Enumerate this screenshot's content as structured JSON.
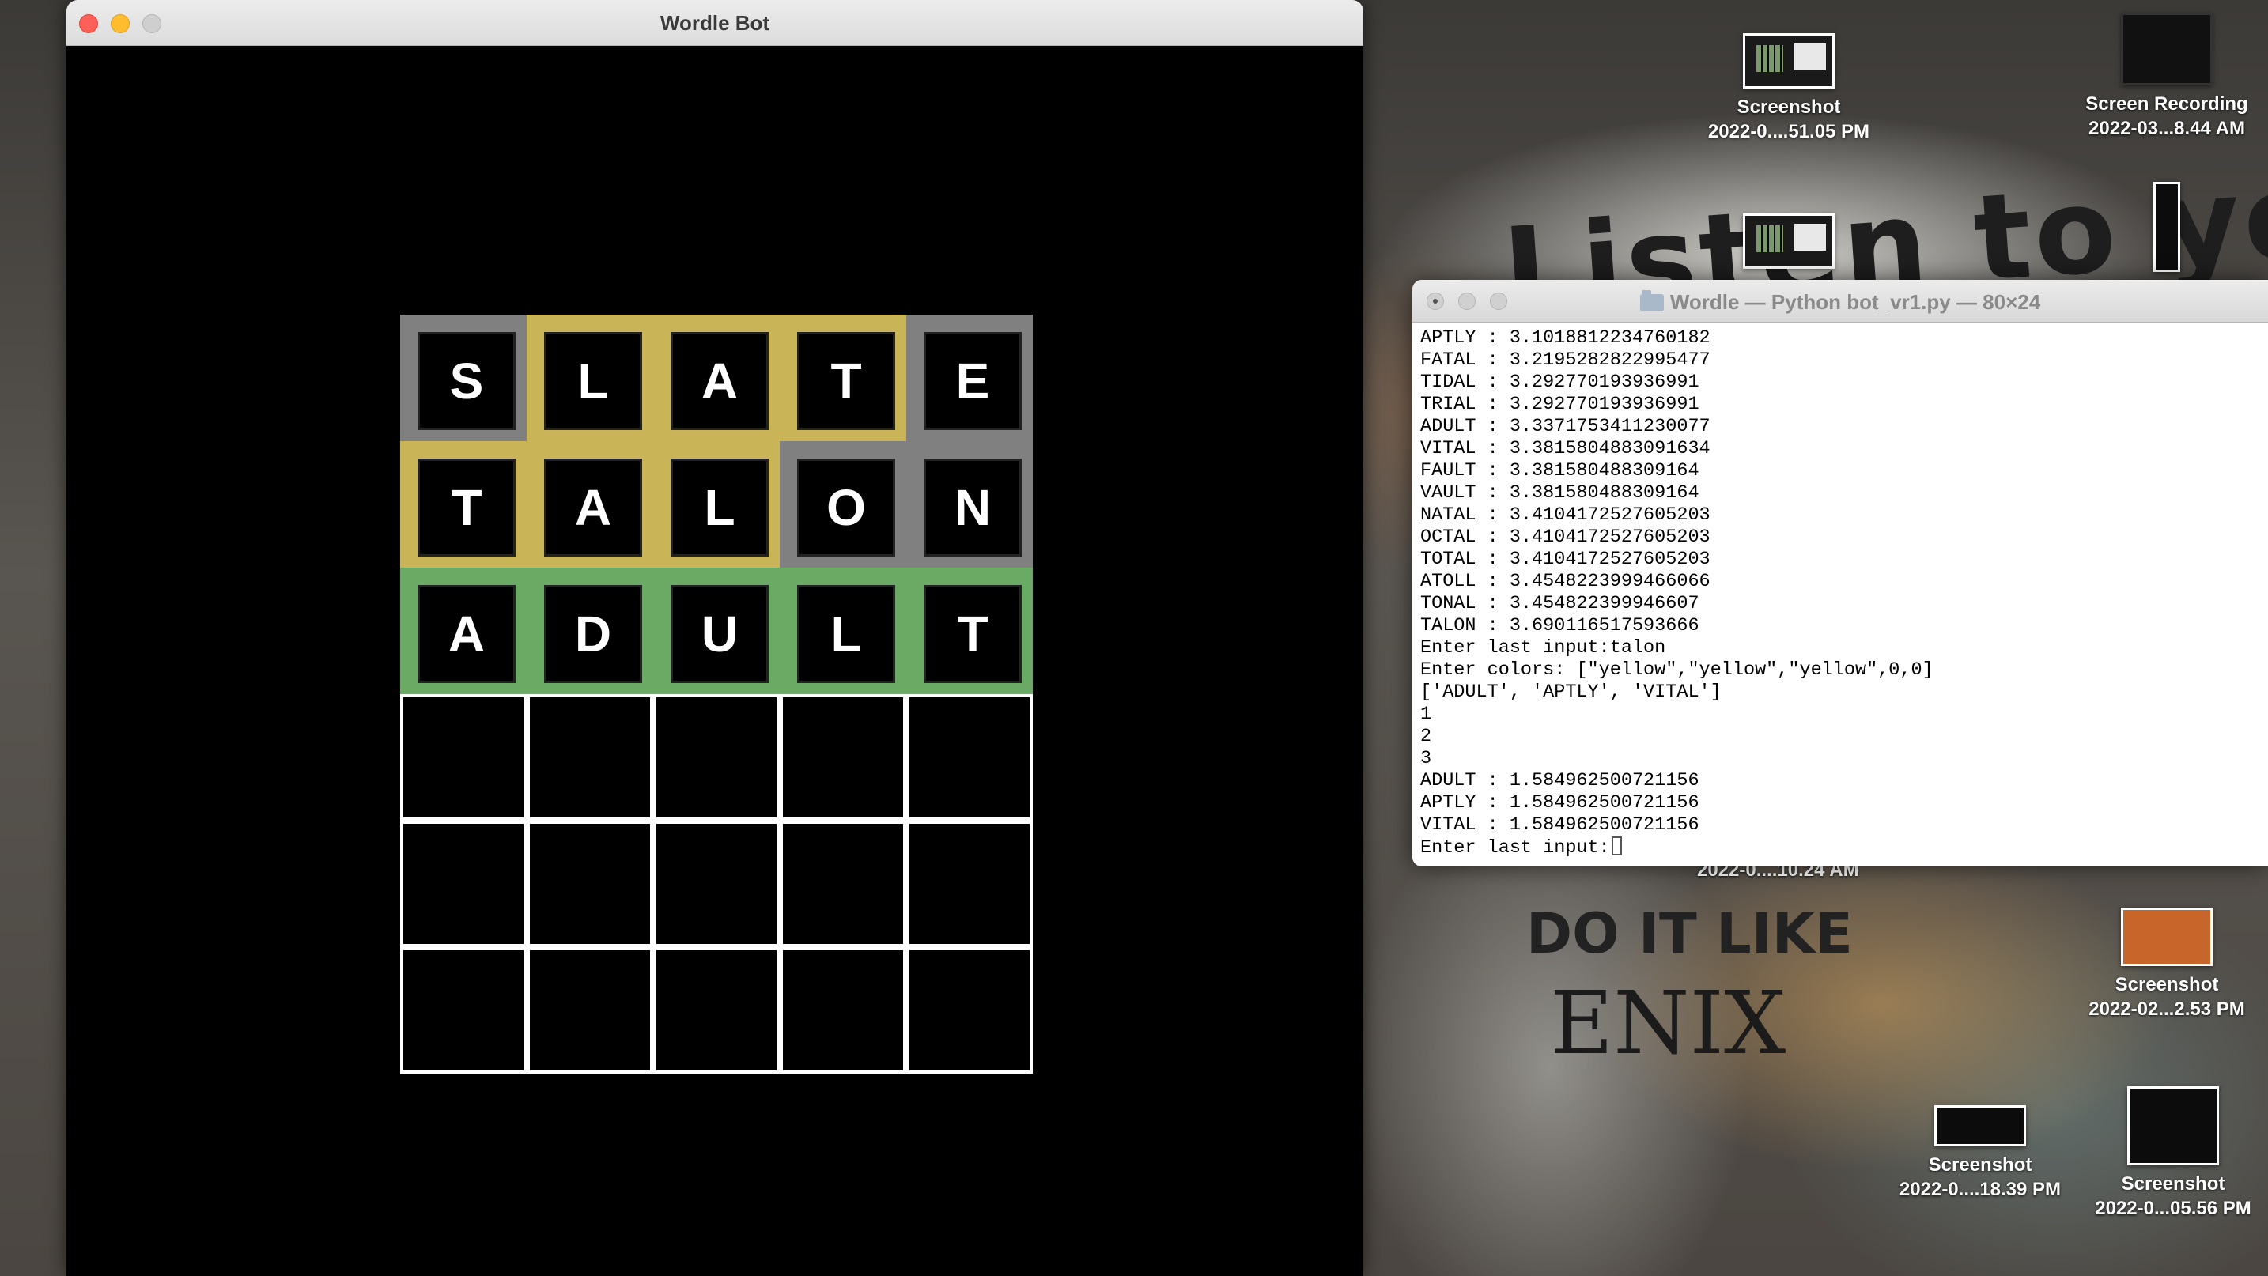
{
  "wordle_window": {
    "title": "Wordle Bot",
    "rows": [
      {
        "letters": [
          "S",
          "L",
          "A",
          "T",
          "E"
        ],
        "colors": [
          "gray",
          "yellow",
          "yellow",
          "yellow",
          "gray"
        ]
      },
      {
        "letters": [
          "T",
          "A",
          "L",
          "O",
          "N"
        ],
        "colors": [
          "yellow",
          "yellow",
          "yellow",
          "gray",
          "gray"
        ]
      },
      {
        "letters": [
          "A",
          "D",
          "U",
          "L",
          "T"
        ],
        "colors": [
          "green",
          "green",
          "green",
          "green",
          "green"
        ]
      },
      {
        "letters": [
          "",
          "",
          "",
          "",
          ""
        ],
        "colors": [
          "none",
          "none",
          "none",
          "none",
          "none"
        ]
      },
      {
        "letters": [
          "",
          "",
          "",
          "",
          ""
        ],
        "colors": [
          "none",
          "none",
          "none",
          "none",
          "none"
        ]
      },
      {
        "letters": [
          "",
          "",
          "",
          "",
          ""
        ],
        "colors": [
          "none",
          "none",
          "none",
          "none",
          "none"
        ]
      }
    ],
    "palette": {
      "gray": "#808080",
      "yellow": "#c9b458",
      "green": "#6aaa64",
      "empty": "#000000"
    }
  },
  "terminal_window": {
    "title": "Wordle — Python bot_vr1.py — 80×24",
    "lines": [
      "APTLY : 3.1018812234760182",
      "FATAL : 3.2195282822995477",
      "TIDAL : 3.292770193936991",
      "TRIAL : 3.292770193936991",
      "ADULT : 3.3371753411230077",
      "VITAL : 3.3815804883091634",
      "FAULT : 3.381580488309164",
      "VAULT : 3.381580488309164",
      "NATAL : 3.4104172527605203",
      "OCTAL : 3.4104172527605203",
      "TOTAL : 3.4104172527605203",
      "ATOLL : 3.4548223999466066",
      "TONAL : 3.454822399946607",
      "TALON : 3.690116517593666",
      "Enter last input:talon",
      "Enter colors: [\"yellow\",\"yellow\",\"yellow\",0,0]",
      "['ADULT', 'APTLY', 'VITAL']",
      "1",
      "2",
      "3",
      "ADULT : 1.584962500721156",
      "APTLY : 1.584962500721156",
      "VITAL : 1.584962500721156"
    ],
    "prompt": "Enter last input:"
  },
  "desktop": {
    "icons": [
      {
        "name": "Screenshot",
        "date": "2022-0....51.05 PM"
      },
      {
        "name": "Screen Recording",
        "date": "2022-03...8.44 AM"
      },
      {
        "name": "Screenshot",
        "date": "2022-02...2.53 PM"
      },
      {
        "name": "Screenshot",
        "date": "2022-0....18.39 PM"
      },
      {
        "name": "Screenshot",
        "date": "2022-0...05.56 PM"
      }
    ],
    "partial_label": "2022-0....10.24 AM",
    "wall_text": [
      "Listen to your",
      "DO IT LIKE",
      "ENIX"
    ]
  }
}
